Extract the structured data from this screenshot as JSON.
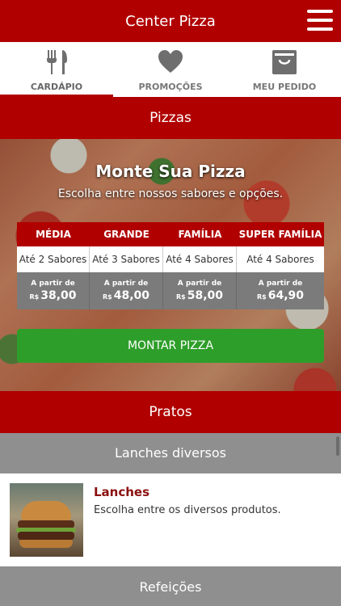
{
  "app": {
    "title": "Center Pizza",
    "accent": "#b00000",
    "button_green": "#2e9e2a"
  },
  "tabs": [
    {
      "label": "CARDÁPIO",
      "icon": "fork-knife-icon",
      "active": true
    },
    {
      "label": "PROMOÇÕES",
      "icon": "heart-icon",
      "active": false
    },
    {
      "label": "MEU PEDIDO",
      "icon": "shopping-bag-icon",
      "active": false
    }
  ],
  "pizzas_section": {
    "title": "Pizzas"
  },
  "hero": {
    "title": "Monte Sua Pizza",
    "subtitle": "Escolha entre nossos sabores e opções.",
    "sizes": [
      {
        "name": "MÉDIA",
        "flavors": "Até 2 Sabores",
        "from_label": "A partir de",
        "currency": "R$",
        "price": "38,00"
      },
      {
        "name": "GRANDE",
        "flavors": "Até 3 Sabores",
        "from_label": "A partir de",
        "currency": "R$",
        "price": "48,00"
      },
      {
        "name": "FAMÍLIA",
        "flavors": "Até 4 Sabores",
        "from_label": "A partir de",
        "currency": "R$",
        "price": "58,00"
      },
      {
        "name": "SUPER FAMÍLIA",
        "flavors": "Até 4 Sabores",
        "from_label": "A partir de",
        "currency": "R$",
        "price": "64,90"
      }
    ],
    "button_label": "MONTAR PIZZA"
  },
  "pratos_section": {
    "title": "Pratos"
  },
  "categories": [
    {
      "title": "Lanches diversos"
    },
    {
      "title": "Refeições"
    }
  ],
  "items": [
    {
      "name": "Lanches",
      "description": "Escolha entre os diversos produtos.",
      "image": "burger-photo"
    }
  ]
}
